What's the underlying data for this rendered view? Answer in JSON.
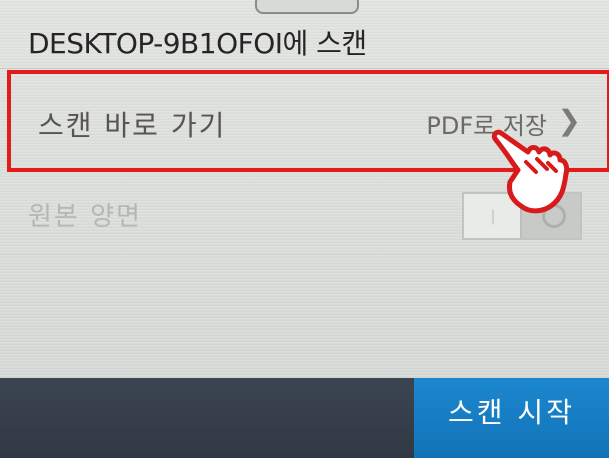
{
  "header": {
    "title": "DESKTOP-9B1OFOI에 스캔"
  },
  "scan_shortcut": {
    "label": "스캔 바로 가기",
    "value": "PDF로 저장",
    "chevron_icon": "chevron-right-icon",
    "highlight_color": "#e31b1b"
  },
  "duplex": {
    "label": "원본 양면",
    "toggle_on_symbol": "ǀ"
  },
  "footer": {
    "start_button_label": "스캔 시작",
    "start_button_color": "#1a80c6"
  },
  "overlay": {
    "pointer_icon": "hand-pointer-icon"
  }
}
